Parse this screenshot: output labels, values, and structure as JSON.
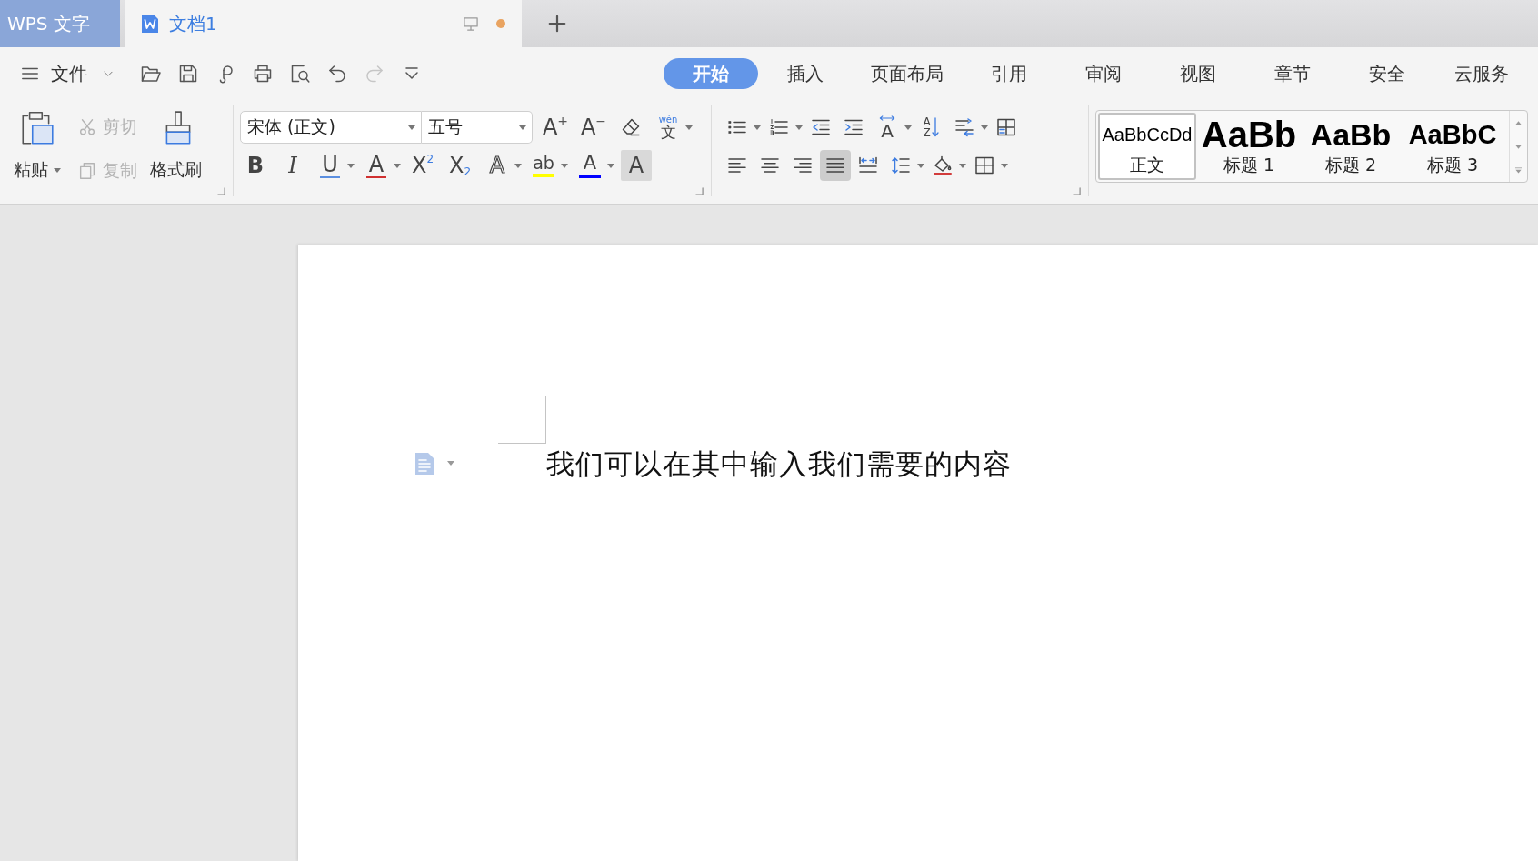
{
  "title_bar": {
    "app_tab": {
      "label": "WPS 文字"
    },
    "document_tabs": [
      {
        "title": "文档1",
        "selected": true,
        "modified": true
      }
    ]
  },
  "menu_bar": {
    "file_menu": {
      "label": "文件"
    },
    "quick_access": [
      {
        "kind": "open",
        "disabled": false
      },
      {
        "kind": "save",
        "disabled": false
      },
      {
        "kind": "export",
        "disabled": false
      },
      {
        "kind": "print",
        "disabled": false
      },
      {
        "kind": "print_preview",
        "disabled": false
      },
      {
        "kind": "undo",
        "disabled": false
      },
      {
        "kind": "redo",
        "disabled": true
      },
      {
        "kind": "customize",
        "disabled": false
      }
    ],
    "tabs": [
      {
        "label": "开始",
        "selected": true
      },
      {
        "label": "插入",
        "selected": false
      },
      {
        "label": "页面布局",
        "selected": false
      },
      {
        "label": "引用",
        "selected": false
      },
      {
        "label": "审阅",
        "selected": false
      },
      {
        "label": "视图",
        "selected": false
      },
      {
        "label": "章节",
        "selected": false
      },
      {
        "label": "安全",
        "selected": false
      },
      {
        "label": "云服务",
        "selected": false
      }
    ]
  },
  "ribbon": {
    "clipboard": [
      {
        "kind": "paste",
        "label": "粘贴",
        "disabled": false,
        "has_menu": true
      },
      {
        "kind": "cut",
        "label": "剪切",
        "disabled": true,
        "has_menu": false
      },
      {
        "kind": "copy",
        "label": "复制",
        "disabled": true,
        "has_menu": false
      },
      {
        "kind": "format_painter",
        "label": "格式刷",
        "disabled": false,
        "has_menu": false
      }
    ],
    "font": {
      "font_name": {
        "value": "宋体 (正文)"
      },
      "font_size": {
        "value": "五号"
      },
      "top_tools": [
        {
          "kind": "grow",
          "glyph": "A",
          "mark": "+",
          "has_menu": false
        },
        {
          "kind": "shrink",
          "glyph": "A",
          "mark": "−",
          "has_menu": false
        },
        {
          "kind": "clear",
          "has_menu": false
        },
        {
          "kind": "pinyin",
          "glyph": "文",
          "mark": "wén",
          "has_menu": true
        }
      ],
      "bottom_tools": [
        {
          "kind": "bold",
          "glyph": "B",
          "has_menu": false
        },
        {
          "kind": "italic",
          "glyph": "I",
          "has_menu": false
        },
        {
          "kind": "underline",
          "glyph": "U",
          "has_menu": true
        },
        {
          "kind": "strikethrough",
          "glyph": "A",
          "has_menu": true
        },
        {
          "kind": "superscript",
          "glyph": "X",
          "mark": "2",
          "has_menu": false
        },
        {
          "kind": "subscript",
          "glyph": "X",
          "mark": "2",
          "has_menu": false
        },
        {
          "kind": "text_effect",
          "glyph": "A",
          "has_menu": true
        },
        {
          "kind": "highlight",
          "glyph": "ab",
          "color": "#ffff00",
          "has_menu": true
        },
        {
          "kind": "font_color",
          "glyph": "A",
          "color": "#0000ff",
          "has_menu": true
        },
        {
          "kind": "char_shading",
          "glyph": "A",
          "has_menu": false
        }
      ]
    },
    "paragraph": {
      "top_tools": [
        {
          "kind": "bullets",
          "has_menu": true
        },
        {
          "kind": "numbering",
          "has_menu": true
        },
        {
          "kind": "outdent",
          "has_menu": false
        },
        {
          "kind": "indent",
          "has_menu": false
        },
        {
          "kind": "text_direction",
          "glyph": "A",
          "has_menu": true
        },
        {
          "kind": "sort",
          "glyph": "A",
          "mark": "Z",
          "has_menu": false
        },
        {
          "kind": "spacing",
          "has_menu": true
        },
        {
          "kind": "table",
          "has_menu": false
        }
      ],
      "alignment": [
        {
          "kind": "left",
          "selected": false
        },
        {
          "kind": "center",
          "selected": false
        },
        {
          "kind": "right",
          "selected": false
        },
        {
          "kind": "justify",
          "selected": true
        },
        {
          "kind": "distributed",
          "selected": false
        }
      ],
      "bottom_tools": [
        {
          "kind": "line_spacing",
          "has_menu": true
        },
        {
          "kind": "shading",
          "has_menu": true
        },
        {
          "kind": "borders",
          "has_menu": true
        }
      ]
    },
    "styles": [
      {
        "kind": "normal",
        "preview": "AaBbCcDd",
        "label": "正文",
        "selected": true
      },
      {
        "kind": "heading_1",
        "preview": "AaBb",
        "label": "标题 1",
        "selected": false
      },
      {
        "kind": "heading_2",
        "preview": "AaBb",
        "label": "标题 2",
        "selected": false
      },
      {
        "kind": "heading_3",
        "preview": "AaBbC",
        "label": "标题 3",
        "selected": false
      }
    ]
  },
  "document": {
    "paragraphs": [
      "我们可以在其中输入我们需要的内容"
    ]
  }
}
